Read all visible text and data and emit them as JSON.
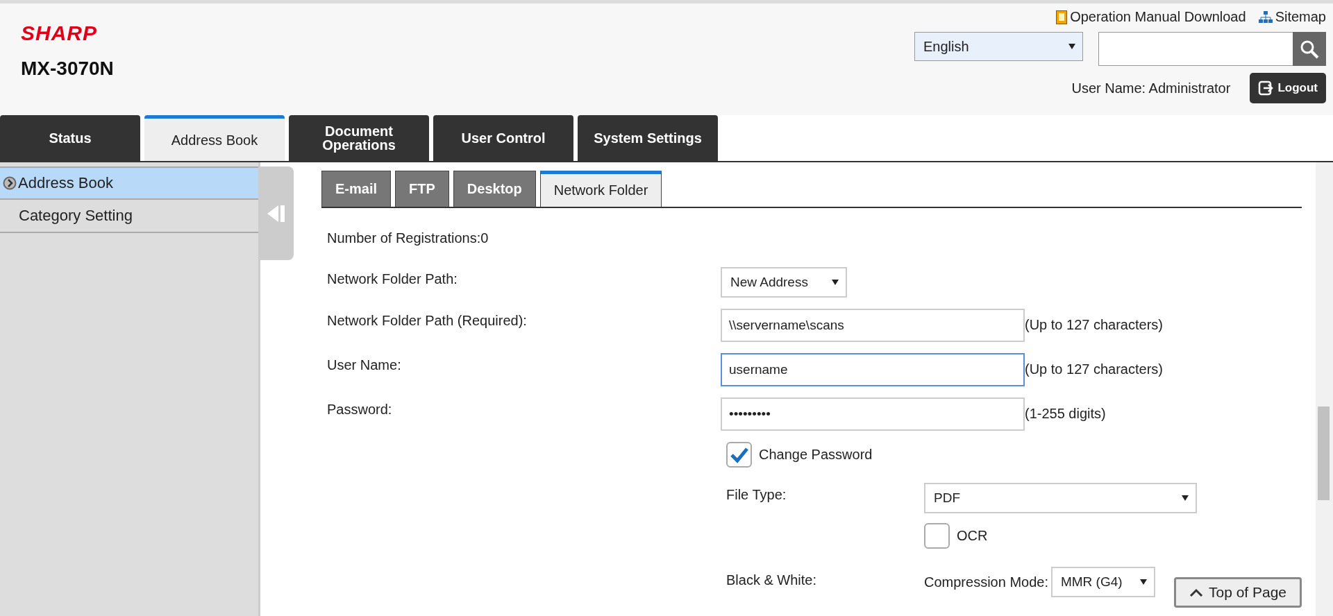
{
  "header": {
    "logo": "SHARP",
    "model": "MX-3070N",
    "links": [
      {
        "kind": "manual",
        "label": "Operation Manual Download"
      },
      {
        "kind": "sitemap",
        "label": "Sitemap"
      }
    ],
    "language": "English",
    "user_label": "User Name: Administrator",
    "logout": "Logout"
  },
  "main_tabs": [
    {
      "label": "Status",
      "selected": false
    },
    {
      "label": "Address Book",
      "selected": true
    },
    {
      "label": "Document Operations",
      "selected": false
    },
    {
      "label": "User Control",
      "selected": false
    },
    {
      "label": "System Settings",
      "selected": false
    }
  ],
  "sidebar": {
    "items": [
      {
        "label": "Address Book",
        "selected": true
      },
      {
        "label": "Category Setting",
        "selected": false
      }
    ]
  },
  "sub_tabs": [
    {
      "label": "E-mail",
      "selected": false
    },
    {
      "label": "FTP",
      "selected": false
    },
    {
      "label": "Desktop",
      "selected": false
    },
    {
      "label": "Network Folder",
      "selected": true
    }
  ],
  "registrations": "Number of Registrations:0",
  "form": {
    "rows": [
      {
        "kind": "select",
        "label": "Network Folder Path:",
        "value": "New Address"
      },
      {
        "kind": "text",
        "label": "Network Folder Path (Required):",
        "value": "\\\\servername\\scans",
        "hint": "(Up to 127 characters)",
        "focused": false
      },
      {
        "kind": "text",
        "label": "User Name:",
        "value": "username",
        "hint": "(Up to 127 characters)",
        "focused": true
      },
      {
        "kind": "text",
        "label": "Password:",
        "value": "•••••••••",
        "hint": "(1-255 digits)",
        "focused": false
      }
    ],
    "change_password": {
      "label": "Change Password",
      "checked": true
    },
    "file_type": {
      "label": "File Type:",
      "value": "PDF",
      "ocr": {
        "label": "OCR",
        "checked": false
      }
    },
    "black_white": {
      "label": "Black & White:",
      "compression_label": "Compression Mode:",
      "compression": "MMR (G4)"
    }
  },
  "top_of_page": "Top of Page"
}
